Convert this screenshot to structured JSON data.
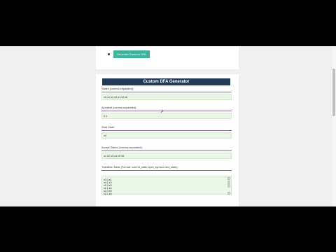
{
  "generate_button": {
    "label": "Generate Random DFA"
  },
  "form": {
    "title": "Custom DFA Generator",
    "states": {
      "label": "States (comma-separated):",
      "value": "s0,s1,s2,s3,s4,s5,s6"
    },
    "alphabet": {
      "label": "Alphabet (comma-separated):",
      "value": "0,1"
    },
    "start_state": {
      "label": "Start State:",
      "value": "s0"
    },
    "accept_states": {
      "label": "Accept States (comma-separated):",
      "value": "s1,s2,s3,s4,s5,s6"
    },
    "transition_table": {
      "label": "Transition Table (Format: current_state,input_symbol,next_state):",
      "lines": [
        "s0,0,s1",
        "s0,1,s2",
        "s1,0,s3",
        "s1,1,s4",
        "s2,0,s5",
        "s2,1,s6"
      ]
    }
  },
  "colors": {
    "title_bar": "#233a57",
    "button": "#3cb39a",
    "input_bg": "#eaf6e6"
  }
}
